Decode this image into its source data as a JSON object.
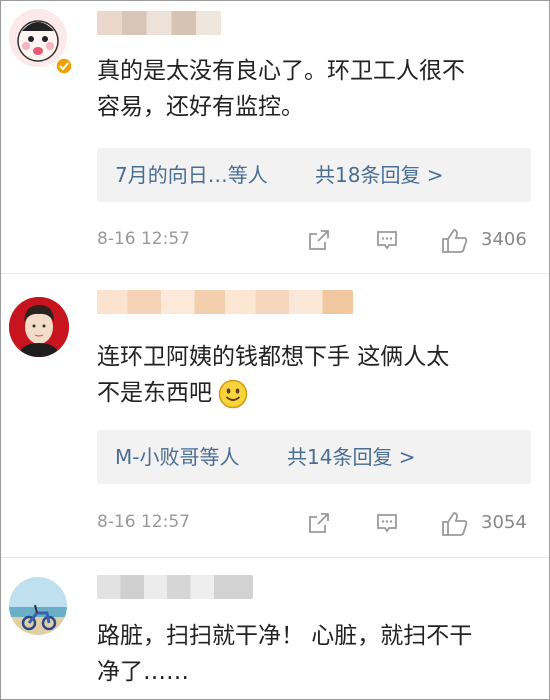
{
  "comments": [
    {
      "text_lines": [
        "真的是太没有良心了。环卫工人很不",
        "容易，还好有监控。"
      ],
      "replies_users": "7月的向日…等人",
      "replies_count": "共18条回复 >",
      "timestamp": "8-16 12:57",
      "likes": "3406"
    },
    {
      "text_lines": [
        "连环卫阿姨的钱都想下手  这俩人太",
        "不是东西吧"
      ],
      "emoji": "smile-emoji",
      "replies_users": "M-小败哥等人",
      "replies_count": "共14条回复 >",
      "timestamp": "8-16 12:57",
      "likes": "3054"
    },
    {
      "text_lines": [
        "路脏，扫扫就干净！ 心脏，就扫不干",
        "净了……"
      ]
    }
  ],
  "icons": {
    "share": "share-icon",
    "comment": "comment-icon",
    "like": "thumbs-up-icon",
    "verified": "verified-badge-icon"
  },
  "colors": {
    "link": "#4a6d92",
    "text": "#222222",
    "meta": "#999999",
    "reply_bg": "#f2f2f2",
    "verified_badge": "#f0a000"
  }
}
